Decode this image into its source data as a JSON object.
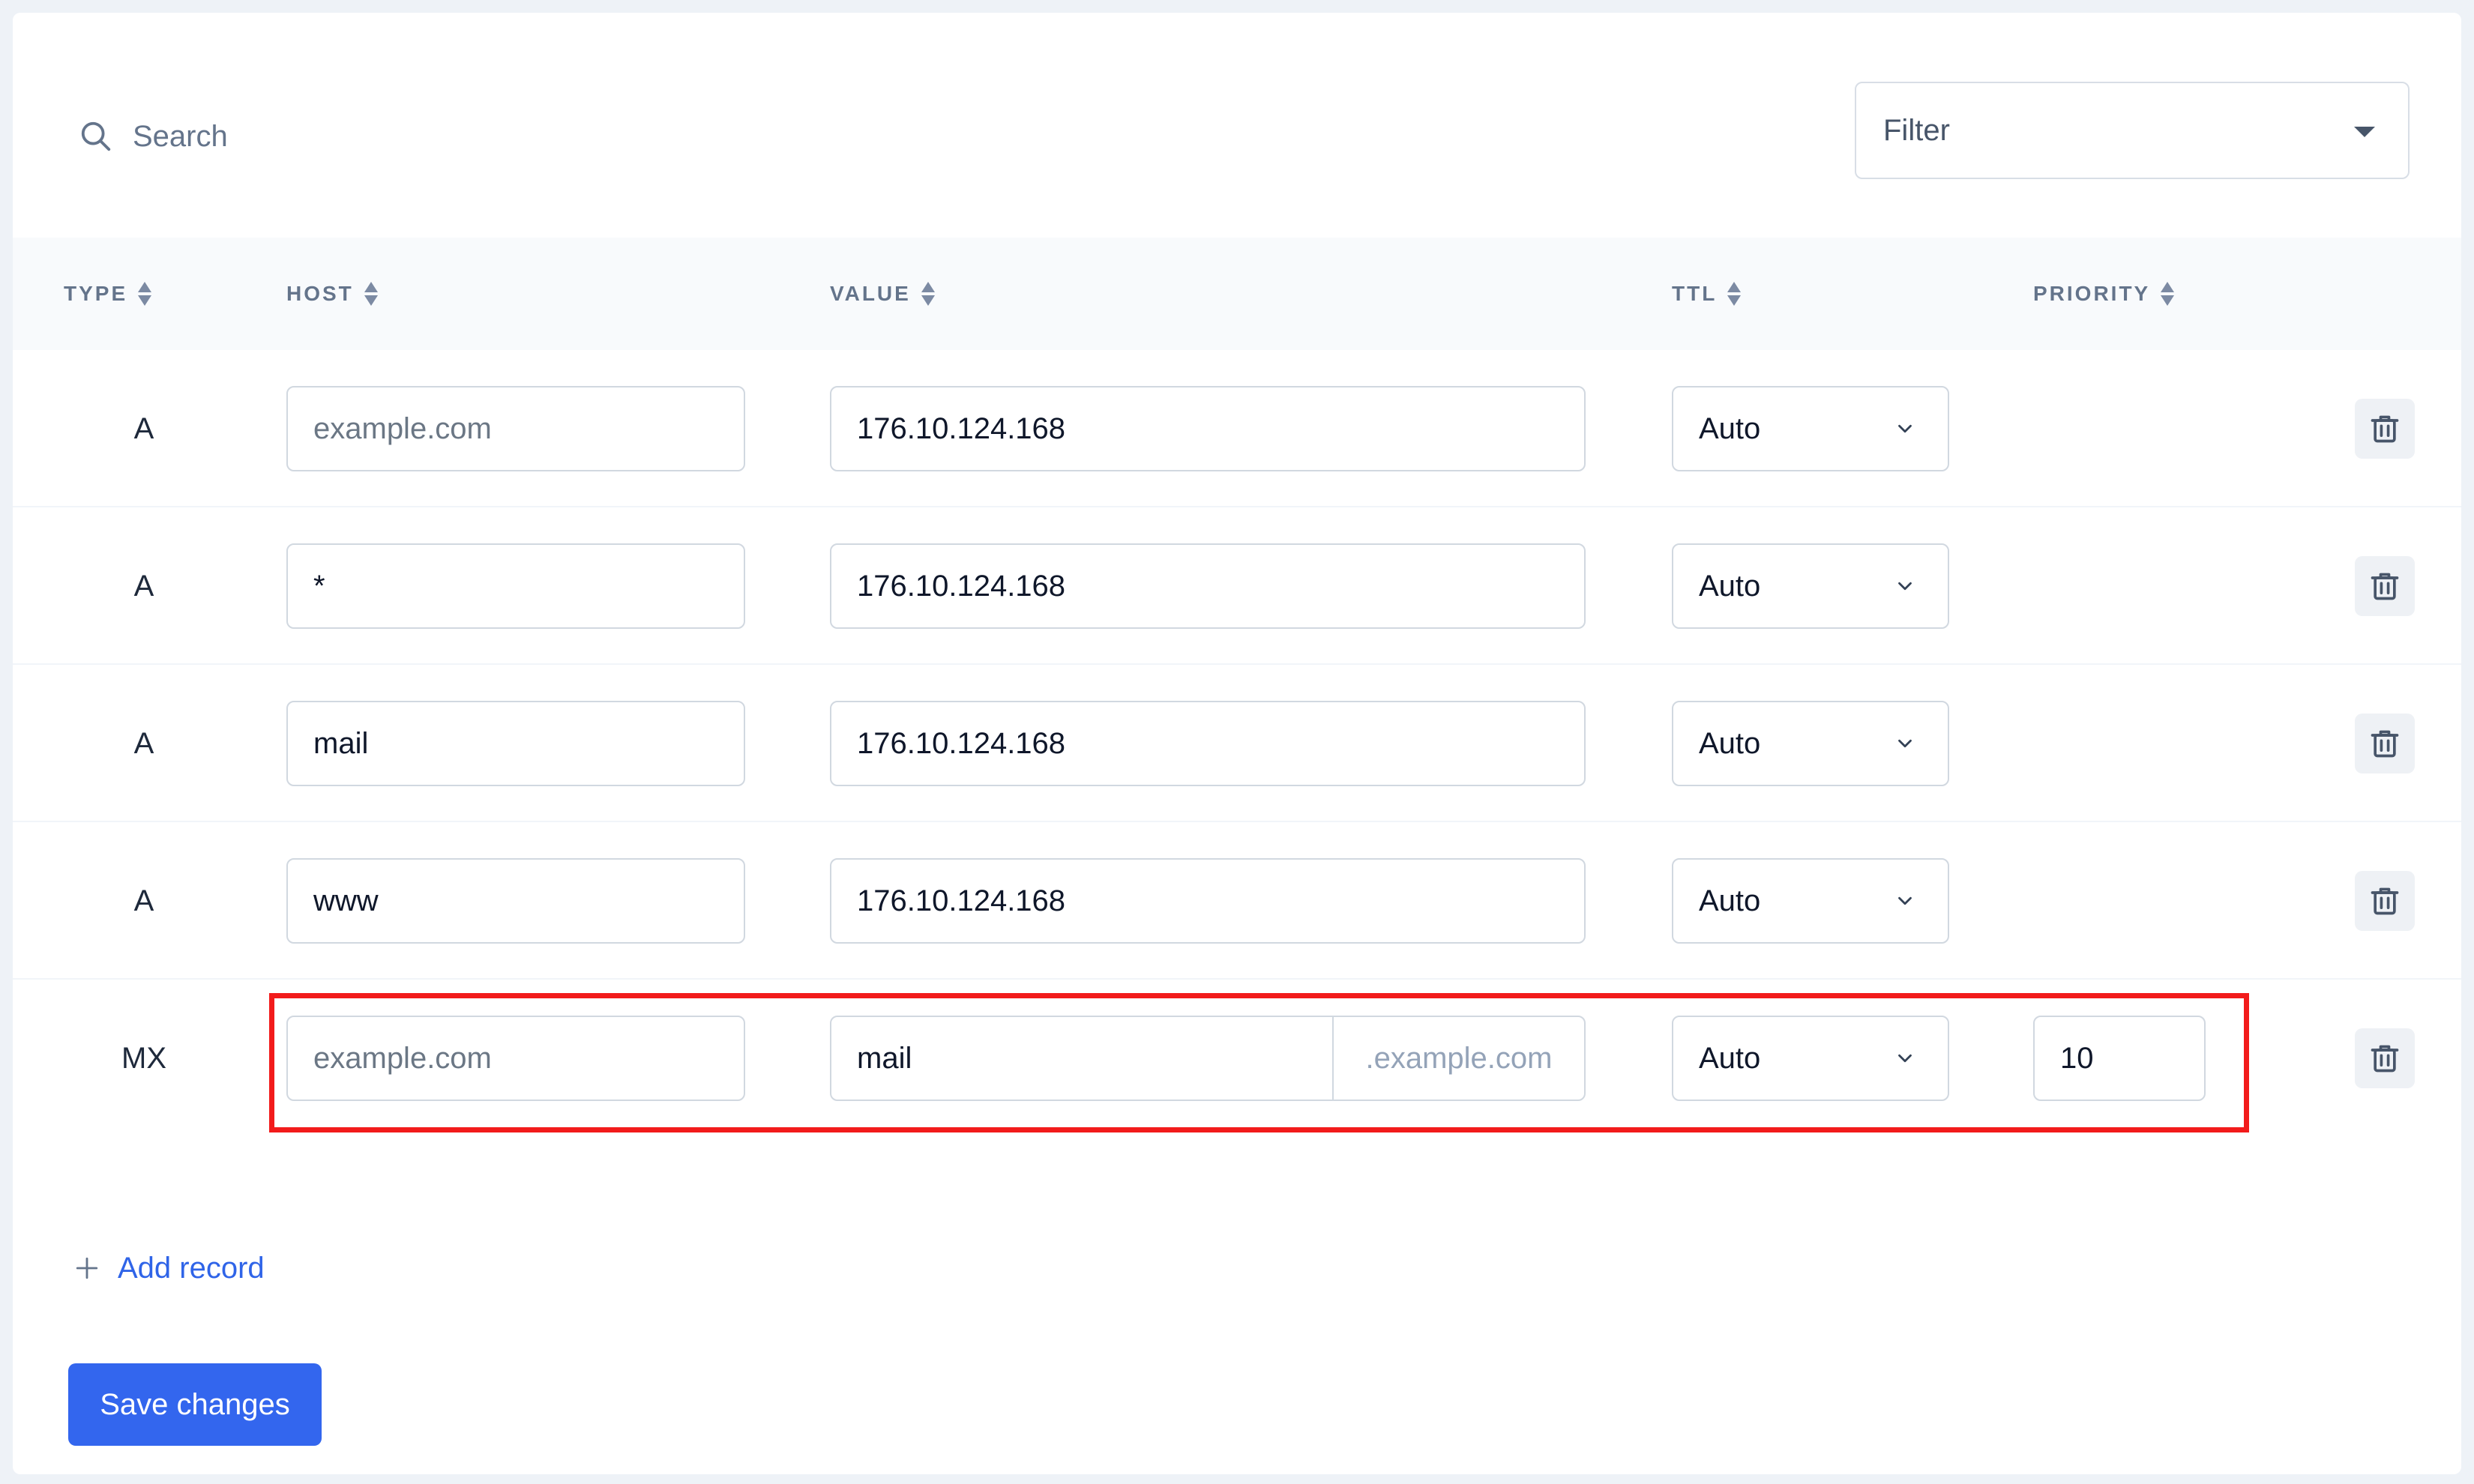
{
  "search": {
    "placeholder": "Search"
  },
  "filter": {
    "label": "Filter"
  },
  "columns": {
    "type": "TYPE",
    "host": "HOST",
    "value": "VALUE",
    "ttl": "TTL",
    "priority": "PRIORITY"
  },
  "records": [
    {
      "type": "A",
      "host": "example.com",
      "value": "176.10.124.168",
      "ttl": "Auto"
    },
    {
      "type": "A",
      "host": "*",
      "value": "176.10.124.168",
      "ttl": "Auto"
    },
    {
      "type": "A",
      "host": "mail",
      "value": "176.10.124.168",
      "ttl": "Auto"
    },
    {
      "type": "A",
      "host": "www",
      "value": "176.10.124.168",
      "ttl": "Auto"
    },
    {
      "type": "MX",
      "host": "example.com",
      "value": "mail",
      "value_suffix": ".example.com",
      "ttl": "Auto",
      "priority": "10"
    }
  ],
  "actions": {
    "add_record": "Add record",
    "save": "Save changes"
  },
  "colors": {
    "accent": "#3366ee",
    "link": "#2f64e8",
    "highlight": "#f21b1b"
  },
  "icons": {
    "search": "search-icon",
    "dropdown": "chevron-down-icon",
    "delete": "trash-icon",
    "add": "plus-icon",
    "sort": "sort-icon"
  }
}
